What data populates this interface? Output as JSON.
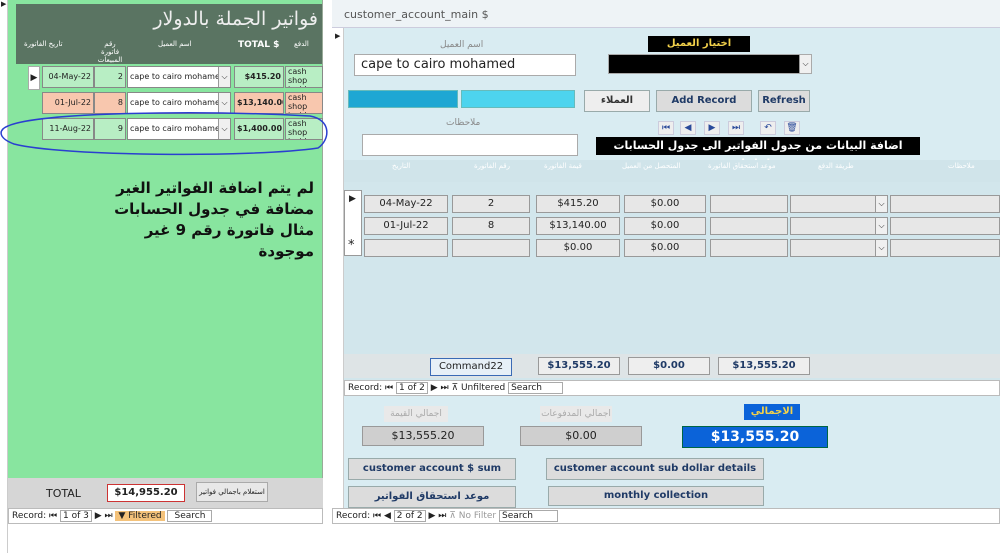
{
  "left_form": {
    "title": "فواتير الجملة بالدولار",
    "headers": [
      "تاريخ الفاتورة",
      "رقم فاتورة المبيعات",
      "اسم العميل",
      "TOTAL $",
      "الدفع"
    ],
    "rows": [
      {
        "date": "04-May-22",
        "num": "2",
        "customer": "cape to cairo mohamed",
        "total": "$415.20",
        "payment": "cash shop inside"
      },
      {
        "date": "01-Jul-22",
        "num": "8",
        "customer": "cape to cairo mohamed",
        "total": "$13,140.00",
        "payment": "cash shop inside"
      },
      {
        "date": "11-Aug-22",
        "num": "9",
        "customer": "cape to cairo mohamed",
        "total": "$1,400.00",
        "payment": "cash shop inside"
      }
    ],
    "note": "لم يتم اضافة الفواتير الغير مضافة في جدول الحسابات مثال فاتورة رقم 9 غير موجودة",
    "total_label": "TOTAL",
    "total_value": "$14,955.20",
    "query_button": "استعلام باجمالي فواتير",
    "record_label": "Record:",
    "record_pos": "1 of 3",
    "filter": "Filtered",
    "search": "Search"
  },
  "right_form": {
    "title": "customer_account_main $",
    "customer_name_label": "اسم العميل",
    "customer_name_value": "cape to cairo mohamed",
    "choose_customer": "اختيار العميل",
    "customers_label": "العملاء",
    "add_record": "Add Record",
    "refresh": "Refresh",
    "notes_label": "ملاحظات",
    "auto_add_note": "اضافة البيانات من جدول الفواتير الى جدول الحسابات تلقائيا",
    "sub_headers": [
      "التاريخ",
      "رقم الفاتورة",
      "قيمة الفاتورة",
      "المتحصل من العميل",
      "موعد استحقاق الفاتورة",
      "طريقة الدفع",
      "ملاحظات"
    ],
    "sub_rows": [
      {
        "date": "04-May-22",
        "num": "2",
        "value": "$415.20",
        "collected": "$0.00"
      },
      {
        "date": "01-Jul-22",
        "num": "8",
        "value": "$13,140.00",
        "collected": "$0.00"
      },
      {
        "date": "",
        "num": "",
        "value": "$0.00",
        "collected": "$0.00"
      }
    ],
    "new_row_marker": "*",
    "command_label": "Command22",
    "sum_value": "$13,555.20",
    "sum_collected": "$0.00",
    "sum_balance": "$13,555.20",
    "sub_record_label": "Record:",
    "sub_record_pos": "1 of 2",
    "sub_filter": "Unfiltered",
    "sub_search": "Search",
    "total_value_label": "اجمالي القيمة",
    "total_paid_label": "اجمالي المدفوعات",
    "grand_total_label": "الاجمالي",
    "total_value": "$13,555.20",
    "total_paid": "$0.00",
    "grand_total": "$13,555.20",
    "btn_sum": "customer account $ sum",
    "btn_sub_details": "customer account sub dollar details",
    "btn_due": "موعد استحقاق الفواتير",
    "btn_monthly": "monthly collection",
    "record_label": "Record:",
    "record_pos": "2 of 2",
    "no_filter": "No Filter",
    "search": "Search"
  }
}
